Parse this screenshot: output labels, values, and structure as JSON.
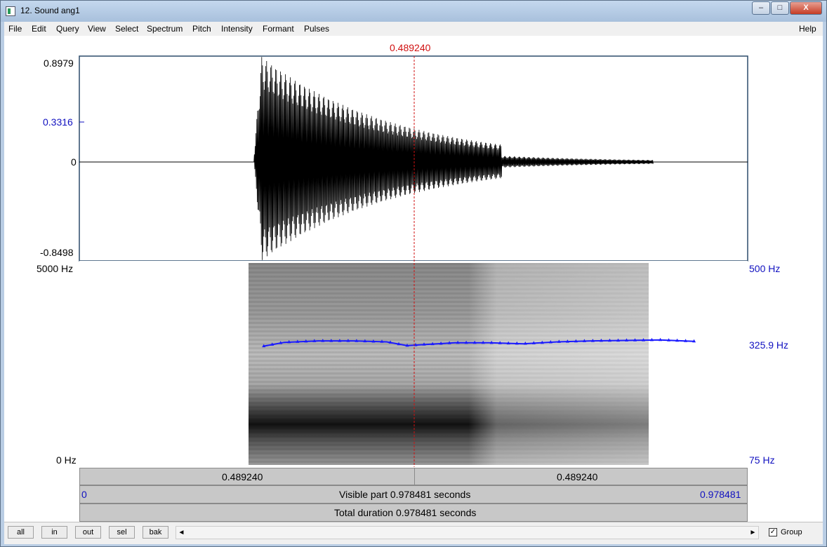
{
  "window": {
    "title": "12. Sound ang1",
    "controls": {
      "minimize": "–",
      "maximize": "□",
      "close": "X"
    }
  },
  "menu": {
    "items": [
      "File",
      "Edit",
      "Query",
      "View",
      "Select",
      "Spectrum",
      "Pitch",
      "Intensity",
      "Formant",
      "Pulses"
    ],
    "help": "Help"
  },
  "cursor": {
    "time_label": "0.489240",
    "time_seconds": 0.48924,
    "color": "#d01010"
  },
  "waveform": {
    "y_max": "0.8979",
    "y_cursor": "0.3316",
    "y_zero": "0",
    "y_min": "-0.8498"
  },
  "spectrogram": {
    "freq_top": "5000 Hz",
    "freq_bottom": "0 Hz",
    "pitch_top": "500 Hz",
    "pitch_value": "325.9 Hz",
    "pitch_bottom": "75 Hz",
    "pitch_color": "#1a1aff"
  },
  "selection": {
    "left_value": "0.489240",
    "right_value": "0.489240"
  },
  "visible": {
    "start": "0",
    "label": "Visible part 0.978481 seconds",
    "end": "0.978481"
  },
  "total": {
    "label": "Total duration 0.978481 seconds"
  },
  "bottom_buttons": {
    "all": "all",
    "in": "in",
    "out": "out",
    "sel": "sel",
    "bak": "bak"
  },
  "scroll": {
    "left_arrow": "◄",
    "right_arrow": "►"
  },
  "group": {
    "label": "Group",
    "checked": true,
    "check_mark": "✓"
  },
  "chart_data": {
    "type": "line",
    "duration_seconds": 0.978481,
    "pitch_range_hz": [
      75,
      500
    ],
    "pitch_series": {
      "x": [
        0.27,
        0.3,
        0.35,
        0.4,
        0.45,
        0.48,
        0.5,
        0.55,
        0.6,
        0.65,
        0.7,
        0.75,
        0.8,
        0.85,
        0.9
      ],
      "y": [
        325,
        333,
        336,
        336,
        334,
        326,
        328,
        332,
        332,
        330,
        334,
        336,
        337,
        338,
        335
      ]
    },
    "waveform_amplitude_range": [
      -0.8498,
      0.8979
    ]
  }
}
